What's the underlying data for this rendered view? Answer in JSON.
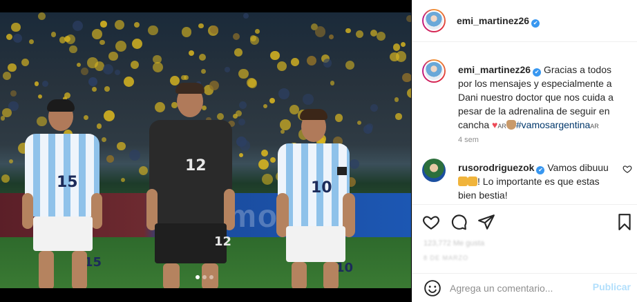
{
  "photo": {
    "carousel_index": 1,
    "carousel_count": 3,
    "ad_text": "mov",
    "players": [
      {
        "number": "15"
      },
      {
        "number": "12"
      },
      {
        "number": "10"
      }
    ]
  },
  "header": {
    "username": "emi_martinez26"
  },
  "caption": {
    "username": "emi_martinez26",
    "text_before": "Gracias a todos por los mensajes y especialmente a Dani nuestro doctor que nos cuida a pesar de la adrenalina de seguir en cancha ",
    "flag_text": "AR",
    "hashtag": "#vamosargentina",
    "flag_text_2": "AR",
    "time": "4 sem"
  },
  "comment": {
    "username": "rusorodriguezok",
    "text_before": "Vamos dibuuu ",
    "text_after": "! Lo importante es que estas bien bestia!"
  },
  "actions": {
    "likes": "123,772 Me gusta",
    "date": "8 DE MARZO"
  },
  "add_comment": {
    "placeholder": "Agrega un comentario...",
    "post_label": "Publicar"
  },
  "colors": {
    "verified": "#3897f0",
    "hashtag": "#00376b",
    "post_disabled": "#b2dffc"
  }
}
